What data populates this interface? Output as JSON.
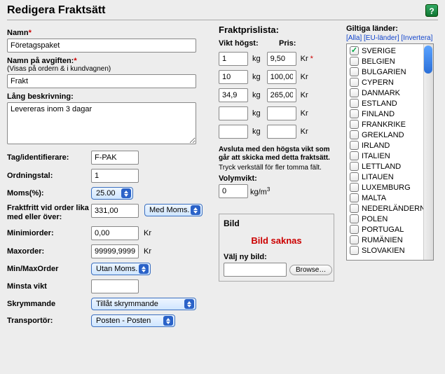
{
  "title": "Redigera Fraktsätt",
  "left": {
    "name_label": "Namn",
    "name_value": "Företagspaket",
    "fee_label": "Namn på avgiften:",
    "fee_sub": "(Visas på ordern & i kundvagnen)",
    "fee_value": "Frakt",
    "longdesc_label": "Lång beskrivning:",
    "longdesc_value": "Levereras inom 3 dagar",
    "tag_label": "Tag/identifierare:",
    "tag_value": "F-PAK",
    "ord_label": "Ordningstal:",
    "ord_value": "1",
    "moms_label": "Moms(%):",
    "moms_value": "25.00",
    "free_label": "Fraktfritt vid order lika med eller över:",
    "free_value": "331,00",
    "free_sel": "Med Moms.",
    "min_label": "Minimiorder:",
    "min_value": "0,00",
    "min_unit": "Kr",
    "max_label": "Maxorder:",
    "max_value": "99999,9999",
    "max_unit": "Kr",
    "minmax_label": "Min/MaxOrder",
    "minmax_sel": "Utan Moms.",
    "minvikt_label": "Minsta vikt",
    "minvikt_value": "",
    "skrym_label": "Skrymmande",
    "skrym_sel": "Tillåt skrymmande",
    "trans_label": "Transportör:",
    "trans_sel": "Posten - Posten"
  },
  "mid": {
    "title": "Fraktprislista:",
    "head_w": "Vikt högst:",
    "head_p": "Pris:",
    "kg": "kg",
    "kr": "Kr",
    "rows": [
      {
        "w": "1",
        "p": "9,50",
        "req": true
      },
      {
        "w": "10",
        "p": "100,00",
        "req": false
      },
      {
        "w": "34,9",
        "p": "265,00",
        "req": false
      },
      {
        "w": "",
        "p": "",
        "req": false
      },
      {
        "w": "",
        "p": "",
        "req": false
      }
    ],
    "note1": "Avsluta med den högsta vikt som går att skicka med detta fraktsätt.",
    "note2": "Tryck verkställ för fler tomma fält.",
    "vol_label": "Volymvikt:",
    "vol_value": "0",
    "vol_unit_pre": "kg/m",
    "vol_unit_sup": "3",
    "bild": {
      "title": "Bild",
      "missing": "Bild saknas",
      "choose": "Välj ny bild:",
      "browse": "Browse…"
    }
  },
  "right": {
    "title": "Giltiga länder:",
    "link_all": "[Alla]",
    "link_eu": "[EU-länder]",
    "link_inv": "[Invertera]",
    "countries": [
      {
        "name": "SVERIGE",
        "checked": true
      },
      {
        "name": "BELGIEN",
        "checked": false
      },
      {
        "name": "BULGARIEN",
        "checked": false
      },
      {
        "name": "CYPERN",
        "checked": false
      },
      {
        "name": "DANMARK",
        "checked": false
      },
      {
        "name": "ESTLAND",
        "checked": false
      },
      {
        "name": "FINLAND",
        "checked": false
      },
      {
        "name": "FRANKRIKE",
        "checked": false
      },
      {
        "name": "GREKLAND",
        "checked": false
      },
      {
        "name": "IRLAND",
        "checked": false
      },
      {
        "name": "ITALIEN",
        "checked": false
      },
      {
        "name": "LETTLAND",
        "checked": false
      },
      {
        "name": "LITAUEN",
        "checked": false
      },
      {
        "name": "LUXEMBURG",
        "checked": false
      },
      {
        "name": "MALTA",
        "checked": false
      },
      {
        "name": "NEDERLÄNDERNA",
        "checked": false
      },
      {
        "name": "POLEN",
        "checked": false
      },
      {
        "name": "PORTUGAL",
        "checked": false
      },
      {
        "name": "RUMÄNIEN",
        "checked": false
      },
      {
        "name": "SLOVAKIEN",
        "checked": false
      }
    ]
  }
}
